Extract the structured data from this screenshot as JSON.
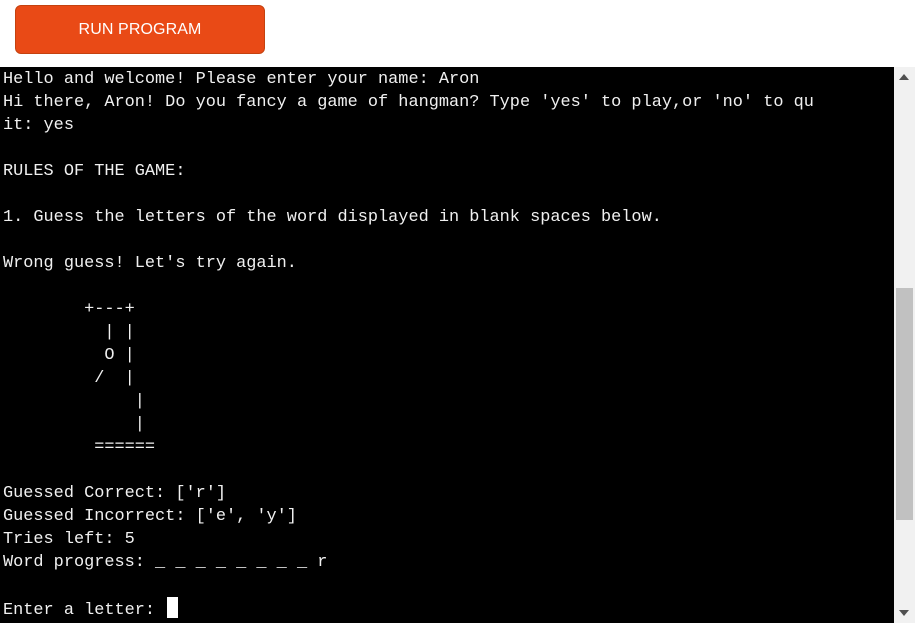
{
  "toolbar": {
    "run_label": "RUN PROGRAM"
  },
  "terminal": {
    "lines": [
      "Hello and welcome! Please enter your name: Aron",
      "Hi there, Aron! Do you fancy a game of hangman? Type 'yes' to play,or 'no' to qu",
      "it: yes",
      "",
      "RULES OF THE GAME:",
      "",
      "1. Guess the letters of the word displayed in blank spaces below.",
      "",
      "Wrong guess! Let's try again.",
      "",
      "        +---+",
      "          | |",
      "          O |",
      "         /  |",
      "             |",
      "             |",
      "         ======",
      "",
      "Guessed Correct: ['r']",
      "Guessed Incorrect: ['e', 'y']",
      "Tries left: 5",
      "Word progress: _ _ _ _ _ _ _ _ r",
      ""
    ],
    "prompt": "Enter a letter: "
  },
  "colors": {
    "button_bg": "#e94a16",
    "terminal_bg": "#000000",
    "terminal_fg": "#f0f0f0"
  }
}
